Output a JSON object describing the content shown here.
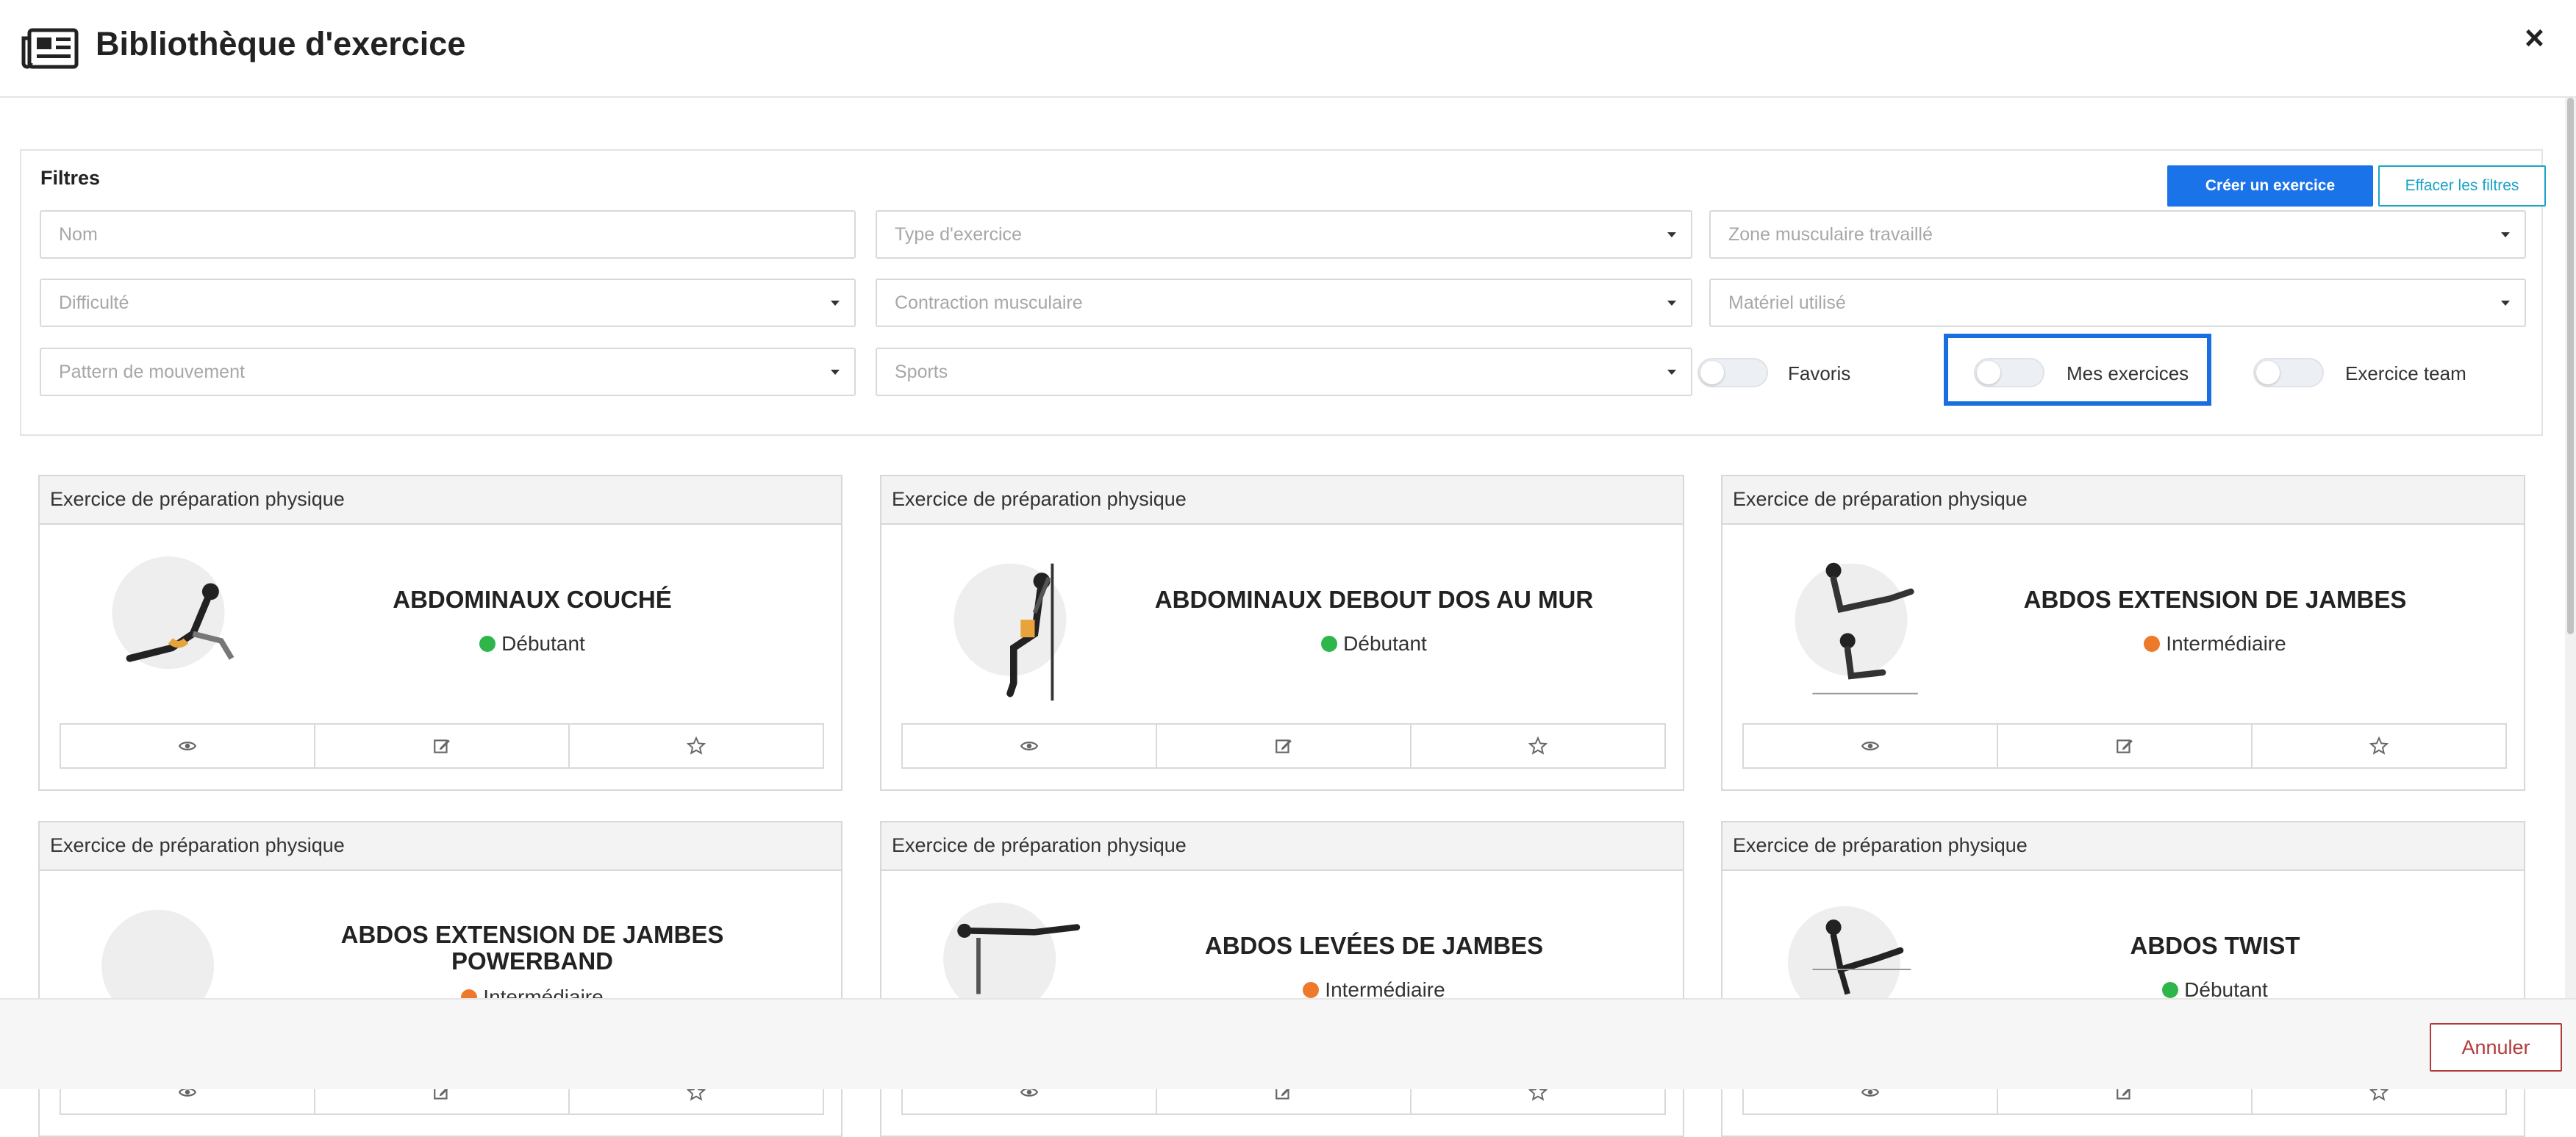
{
  "header": {
    "title": "Bibliothèque d'exercice",
    "icon": "newspaper-icon",
    "close_label": "×"
  },
  "filters": {
    "title": "Filtres",
    "create_label": "Créer un exercice",
    "clear_label": "Effacer les filtres",
    "fields": {
      "nom": "Nom",
      "type": "Type d'exercice",
      "zone": "Zone musculaire travaillé",
      "difficulte": "Difficulté",
      "contraction": "Contraction musculaire",
      "materiel": "Matériel utilisé",
      "pattern": "Pattern de mouvement",
      "sports": "Sports"
    },
    "toggles": {
      "favoris": "Favoris",
      "mes_exercices": "Mes exercices",
      "exercice_team": "Exercice team"
    }
  },
  "cards": [
    {
      "type": "Exercice de préparation physique",
      "name": "ABDOMINAUX COUCHÉ",
      "level": "Débutant",
      "level_color": "#2fb64a"
    },
    {
      "type": "Exercice de préparation physique",
      "name": "ABDOMINAUX DEBOUT DOS AU MUR",
      "level": "Débutant",
      "level_color": "#2fb64a"
    },
    {
      "type": "Exercice de préparation physique",
      "name": "ABDOS EXTENSION DE JAMBES",
      "level": "Intermédiaire",
      "level_color": "#ec7a2a"
    },
    {
      "type": "Exercice de préparation physique",
      "name": "ABDOS EXTENSION DE JAMBES POWERBAND",
      "level": "Intermédiaire",
      "level_color": "#ec7a2a"
    },
    {
      "type": "Exercice de préparation physique",
      "name": "ABDOS LEVÉES DE JAMBES",
      "level": "Intermédiaire",
      "level_color": "#ec7a2a"
    },
    {
      "type": "Exercice de préparation physique",
      "name": "ABDOS TWIST",
      "level": "Débutant",
      "level_color": "#2fb64a"
    }
  ],
  "card_actions": [
    "eye-icon",
    "edit-icon",
    "star-icon"
  ],
  "footer": {
    "cancel_label": "Annuler"
  },
  "colors": {
    "primary": "#1a73e8",
    "secondary": "#1aa3c8",
    "danger": "#b23a3a",
    "highlight": "#1a6fe0"
  }
}
